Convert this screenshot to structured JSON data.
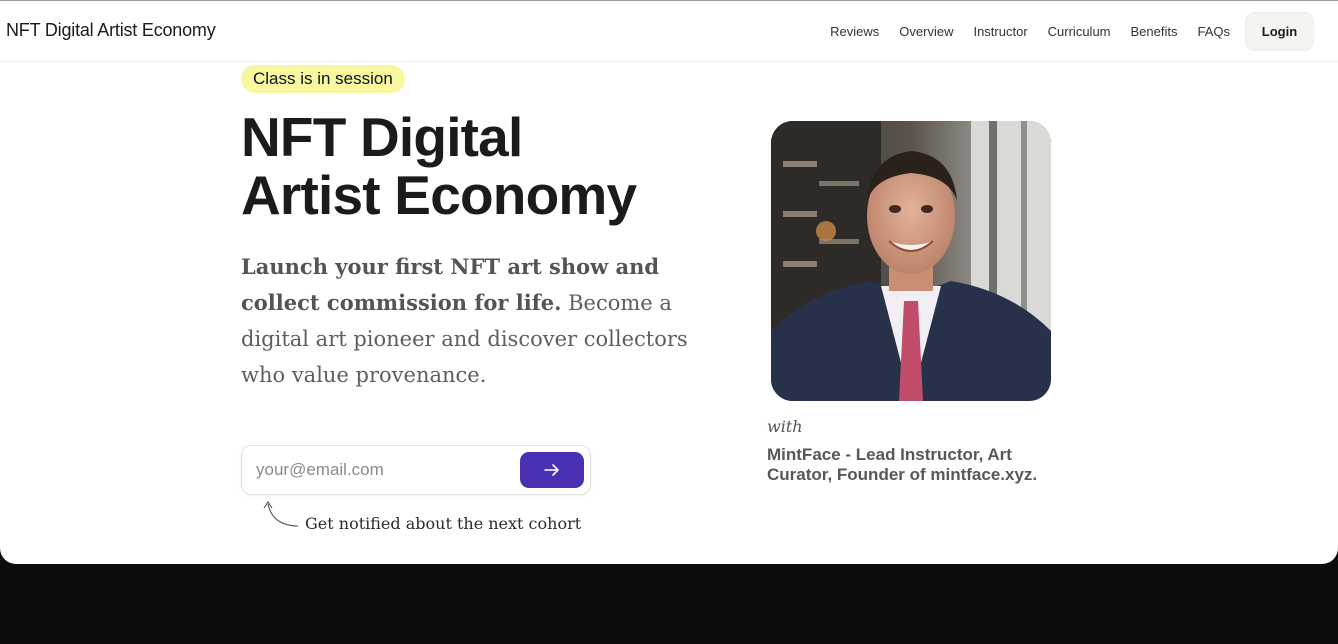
{
  "header": {
    "brand": "NFT Digital Artist Economy",
    "nav": [
      "Reviews",
      "Overview",
      "Instructor",
      "Curriculum",
      "Benefits",
      "FAQs"
    ],
    "login_label": "Login"
  },
  "hero": {
    "badge": "Class is in session",
    "title_line1": "NFT Digital",
    "title_line2": "Artist Economy",
    "lede_bold": "Launch your first NFT art show and collect commission for life.",
    "lede_rest": "Become a digital art pioneer and discover collectors who value provenance.",
    "email_placeholder": "your@email.com",
    "hint": "Get notified about the next cohort"
  },
  "instructor": {
    "with_label": "with",
    "credit": "MintFace - Lead Instructor, Art Curator, Founder of mintface.xyz."
  },
  "colors": {
    "accent": "#4b2fb3",
    "badge_bg": "#f7f7a0",
    "footer_bg": "#0d0d0d"
  }
}
